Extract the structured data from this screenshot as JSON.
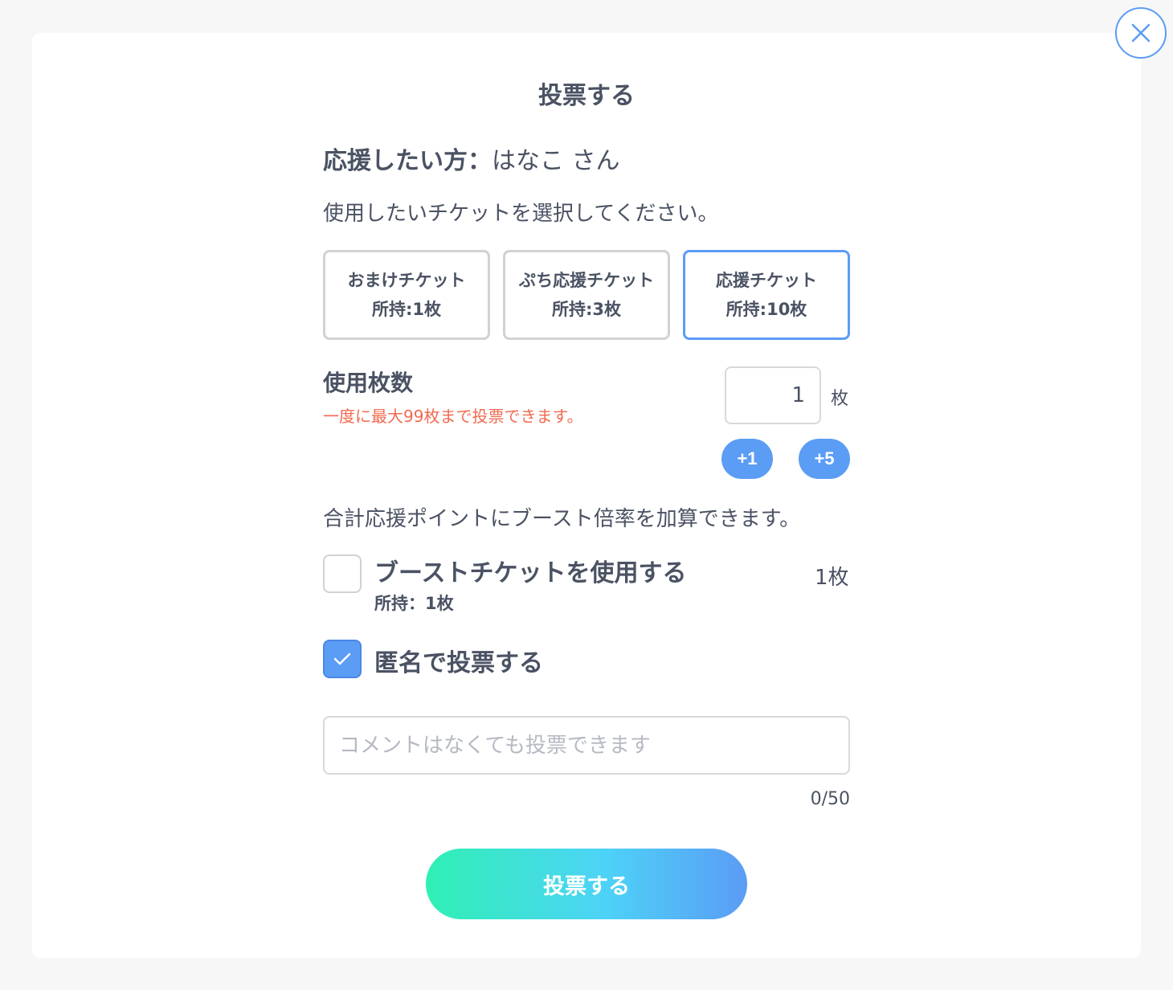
{
  "modal": {
    "title": "投票する",
    "supporter_label": "応援したい方：",
    "supporter_name": "はなこ さん",
    "instruction": "使用したいチケットを選択してください。"
  },
  "tickets": [
    {
      "name": "おまけチケット",
      "owned": "所持:1枚",
      "selected": false
    },
    {
      "name": "ぷち応援チケット",
      "owned": "所持:3枚",
      "selected": false
    },
    {
      "name": "応援チケット",
      "owned": "所持:10枚",
      "selected": true
    }
  ],
  "quantity": {
    "label": "使用枚数",
    "note": "一度に最大99枚まで投票できます。",
    "value": "1",
    "unit": "枚",
    "plus_one": "+1",
    "plus_five": "+5"
  },
  "boost": {
    "description": "合計応援ポイントにブースト倍率を加算できます。",
    "label": "ブーストチケットを使用する",
    "owned": "所持：1枚",
    "count": "1枚",
    "checked": false
  },
  "anonymous": {
    "label": "匿名で投票する",
    "checked": true
  },
  "comment": {
    "placeholder": "コメントはなくても投票できます",
    "value": "",
    "counter": "0/50"
  },
  "submit_label": "投票する",
  "colors": {
    "accent": "#5b9cf5",
    "text": "#4a5263",
    "warning": "#f06a50",
    "gradient_start": "#2ff0b4",
    "gradient_end": "#5b9cf5"
  }
}
